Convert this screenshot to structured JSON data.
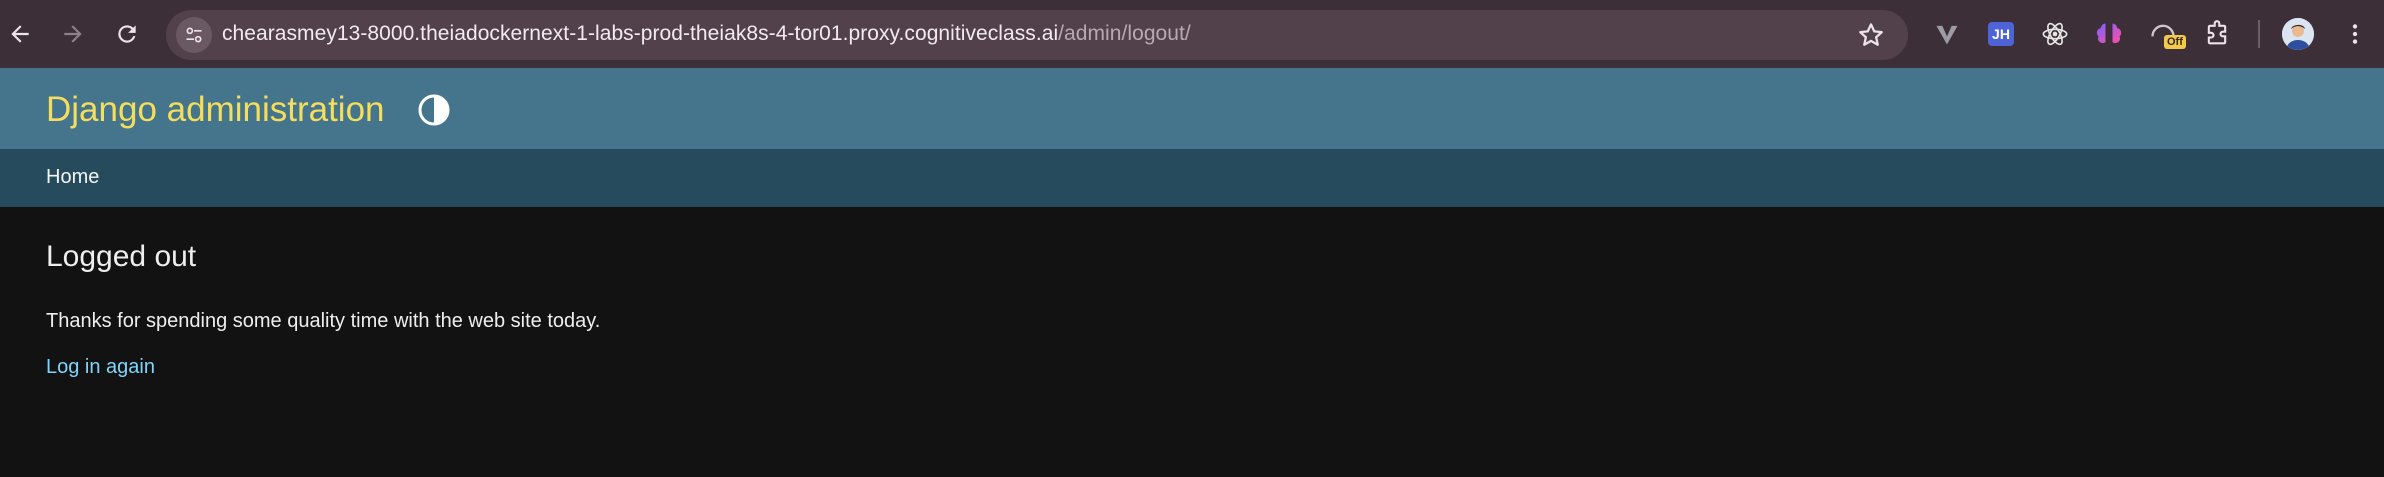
{
  "browser": {
    "url_host": "chearasmey13-8000.theiadockernext-1-labs-prod-theiak8s-4-tor01.proxy.cognitiveclass.ai",
    "url_path": "/admin/logout/",
    "extensions": {
      "jh_label": "JH",
      "off_label": "Off"
    }
  },
  "django": {
    "site_header": "Django administration",
    "breadcrumb_home": "Home",
    "page_title": "Logged out",
    "message": "Thanks for spending some quality time with the web site today.",
    "login_again": "Log in again"
  },
  "colors": {
    "header_bg": "#44758d",
    "branding": "#f5dd5d",
    "breadcrumb_bg": "#264b5d",
    "body_bg": "#121212",
    "link": "#81d4fa"
  },
  "icons": [
    "back-arrow-icon",
    "forward-arrow-icon",
    "reload-icon",
    "site-info-icon",
    "star-icon",
    "vivaldi-v-icon",
    "jh-extension-icon",
    "react-icon",
    "ai-brain-icon",
    "off-extension-icon",
    "puzzle-extensions-icon",
    "profile-avatar",
    "more-menu-icon",
    "theme-toggle-icon"
  ]
}
